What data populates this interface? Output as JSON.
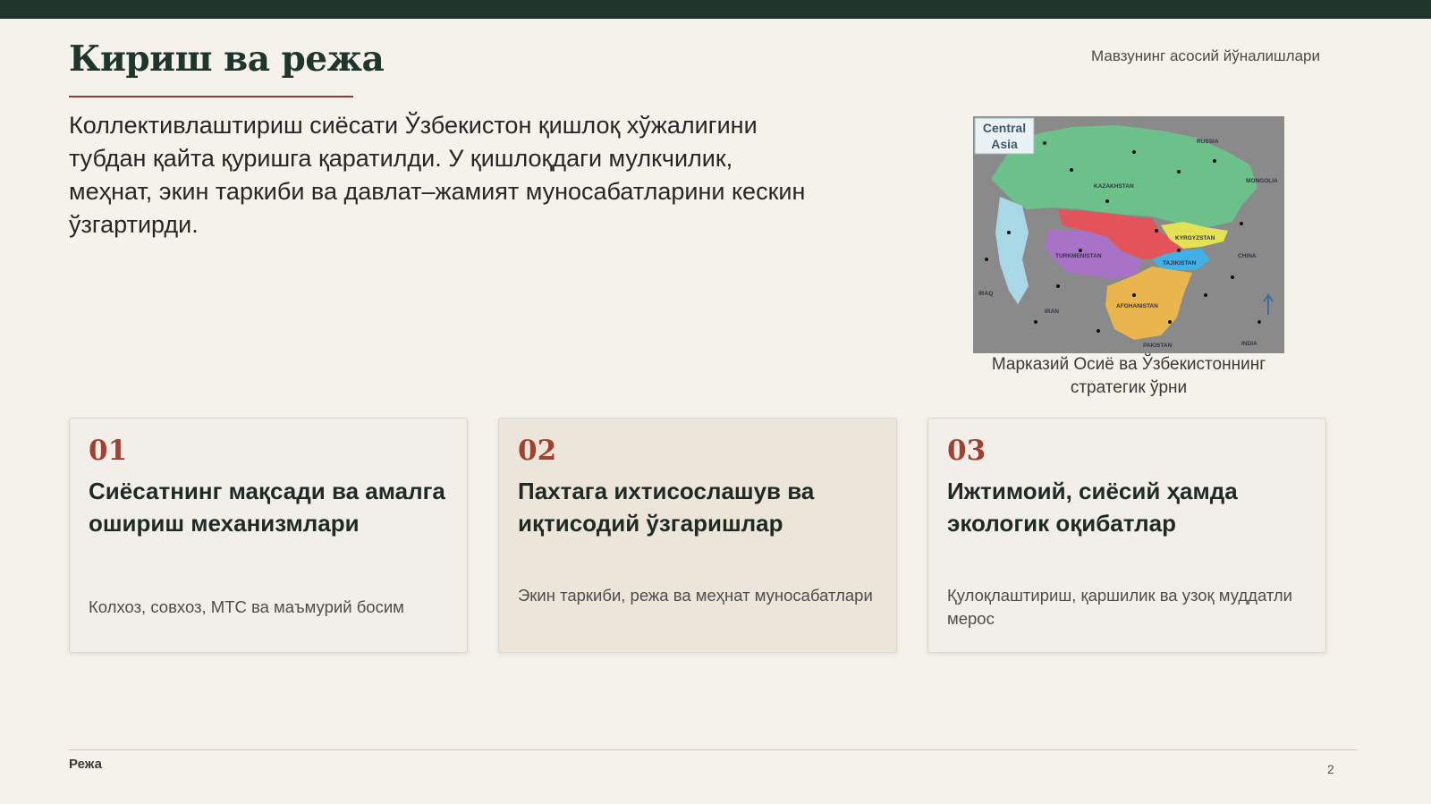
{
  "header": {
    "title": "Кириш ва режа",
    "subtitle": "Мавзунинг асосий йўналишлари"
  },
  "intro": "Коллективлаштириш сиёсати Ўзбекистон қишлоқ хўжалигини тубдан қайта қуришга қаратилди. У қишлоқдаги мулкчилик, меҳнат, экин таркиби ва давлат–жамият муносабатларини кескин ўзгартирди.",
  "map": {
    "badge_line1": "Central",
    "badge_line2": "Asia",
    "labels": [
      "KAZAKHSTAN",
      "KYRGYZSTAN",
      "TAJIKISTAN",
      "TURKMENISTAN",
      "AFGHANISTAN",
      "IRAN",
      "CHINA",
      "PAKISTAN",
      "RUSSIA",
      "INDIA",
      "IRAQ",
      "MONGOLIA"
    ],
    "caption": "Марказий Осиё ва Ўзбекистоннинг стратегик ўрни",
    "colors": {
      "kazakhstan": "#6cc18a",
      "uzbekistan": "#e2545a",
      "turkmenistan": "#a872c6",
      "kyrgyzstan": "#e3e255",
      "tajikistan": "#3fb1e6",
      "afghanistan": "#e8b64d",
      "sea": "#a8d8e6",
      "other": "#8a8a8a"
    }
  },
  "cards": [
    {
      "num": "01",
      "title": "Сиёсатнинг мақсади ва амалга ошириш механизмлари",
      "desc": "Колхоз, совхоз, МТС ва маъмурий босим"
    },
    {
      "num": "02",
      "title": "Пахтага ихтисослашув ва иқтисодий ўзгаришлар",
      "desc": "Экин таркиби, режа ва меҳнат муносабатлари"
    },
    {
      "num": "03",
      "title": "Ижтимоий, сиёсий ҳамда экологик оқибатлар",
      "desc": "Қулоқлаштириш, қаршилик ва узоқ муддатли мерос"
    }
  ],
  "footer": {
    "label": "Режа",
    "page": "2"
  },
  "colors": {
    "topbar": "#20352c",
    "accent": "#a3412f",
    "background": "#f5f2ec"
  }
}
